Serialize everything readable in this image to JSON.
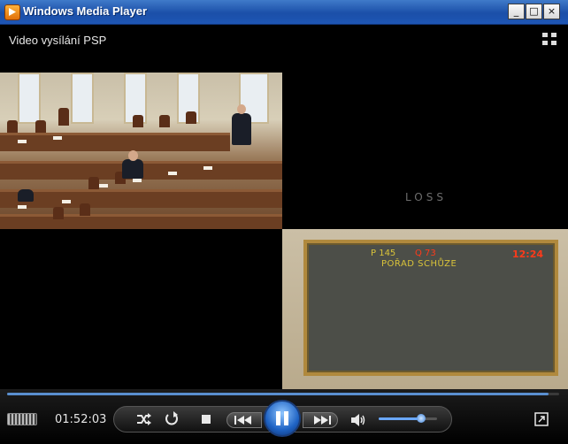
{
  "window": {
    "title": "Windows Media Player",
    "buttons": {
      "minimize": "_",
      "maximize": "□",
      "close": "×"
    }
  },
  "video": {
    "title": "Video vysílání PSP",
    "overlay_text": "LOSS",
    "board": {
      "p": "P 145",
      "q": "Q 73",
      "time": "12:24",
      "agenda": "POŘAD SCHŮZE"
    }
  },
  "controls": {
    "elapsed": "01:52:03",
    "seek_fraction": 0.98,
    "volume_fraction": 0.72,
    "accent_color": "#1f63c4"
  }
}
